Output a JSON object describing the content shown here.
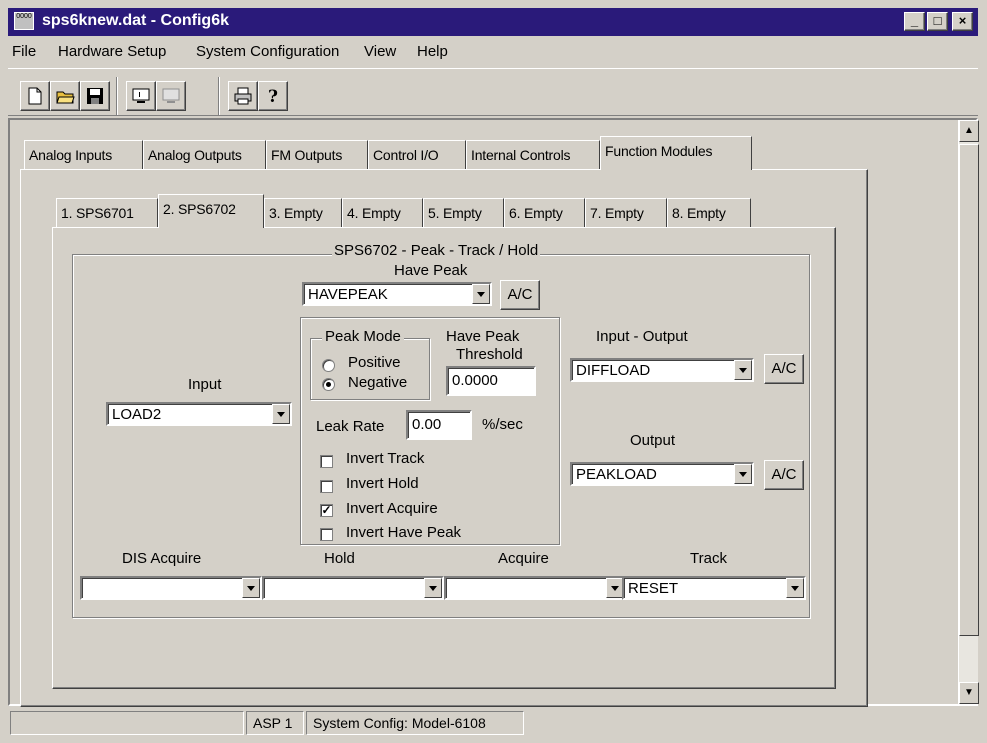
{
  "window": {
    "title": "sps6knew.dat - Config6k",
    "icon_text": "0000",
    "buttons": {
      "minimize": "_",
      "maximize": "□",
      "close": "×"
    }
  },
  "menu": [
    "File",
    "Hardware Setup",
    "System Configuration",
    "View",
    "Help"
  ],
  "toolbar": {
    "icons": [
      "new-file-icon",
      "open-folder-icon",
      "save-disk-icon",
      "monitor-icon",
      "disabled-monitor-icon",
      "print-icon",
      "help-icon"
    ]
  },
  "main_tabs": [
    "Analog Inputs",
    "Analog Outputs",
    "FM Outputs",
    "Control I/O",
    "Internal Controls",
    "Function Modules"
  ],
  "module_tabs": [
    "1. SPS6701",
    "2. SPS6702",
    "3. Empty",
    "4. Empty",
    "5. Empty",
    "6. Empty",
    "7. Empty",
    "8. Empty"
  ],
  "module": {
    "title": "SPS6702 - Peak - Track / Hold",
    "have_peak": {
      "label": "Have Peak",
      "value": "HAVEPEAK",
      "ac": "A/C"
    },
    "input": {
      "label": "Input",
      "value": "LOAD2"
    },
    "peak_mode": {
      "label": "Peak Mode",
      "positive": "Positive",
      "negative": "Negative",
      "selected": "Negative"
    },
    "threshold": {
      "label_1": "Have Peak",
      "label_2": "Threshold",
      "value": "0.0000"
    },
    "leak_rate": {
      "label": "Leak Rate",
      "value": "0.00",
      "unit": "%/sec"
    },
    "checkboxes": [
      {
        "label": "Invert Track",
        "checked": false
      },
      {
        "label": "Invert Hold",
        "checked": false
      },
      {
        "label": "Invert Acquire",
        "checked": true
      },
      {
        "label": "Invert Have Peak",
        "checked": false
      }
    ],
    "input_output": {
      "label": "Input - Output",
      "value": "DIFFLOAD",
      "ac": "A/C"
    },
    "output": {
      "label": "Output",
      "value": "PEAKLOAD",
      "ac": "A/C"
    },
    "dis_acquire": {
      "label": "DIS Acquire",
      "value": ""
    },
    "hold": {
      "label": "Hold",
      "value": ""
    },
    "acquire": {
      "label": "Acquire",
      "value": ""
    },
    "track": {
      "label": "Track",
      "value": "RESET"
    }
  },
  "status": {
    "asp": "ASP 1",
    "config": "System Config: Model-6108"
  },
  "colors": {
    "titlebar": "#2a1a7a",
    "face": "#d4d0c8"
  }
}
